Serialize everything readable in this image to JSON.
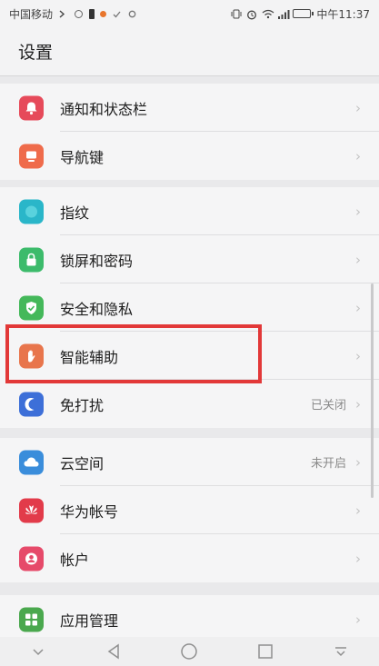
{
  "status_bar": {
    "carrier": "中国移动",
    "time": "中午11:37"
  },
  "header": {
    "title": "设置"
  },
  "groups": [
    {
      "items": [
        {
          "label": "通知和状态栏",
          "icon": "bell-icon",
          "color": "#e64a5a"
        },
        {
          "label": "导航键",
          "icon": "navigation-key-icon",
          "color": "#ef6b4b"
        }
      ]
    },
    {
      "items": [
        {
          "label": "指纹",
          "icon": "fingerprint-icon",
          "color": "#2ab6c9"
        },
        {
          "label": "锁屏和密码",
          "icon": "lock-icon",
          "color": "#3cbb6b"
        },
        {
          "label": "安全和隐私",
          "icon": "shield-icon",
          "color": "#44b85a"
        },
        {
          "label": "智能辅助",
          "icon": "hand-icon",
          "color": "#e8754c"
        },
        {
          "label": "免打扰",
          "icon": "moon-icon",
          "color": "#3d6fd8",
          "value": "已关闭"
        }
      ]
    },
    {
      "items": [
        {
          "label": "云空间",
          "icon": "cloud-icon",
          "color": "#3a8ddb",
          "value": "未开启"
        },
        {
          "label": "华为帐号",
          "icon": "huawei-icon",
          "color": "#e23b4a"
        },
        {
          "label": "帐户",
          "icon": "account-icon",
          "color": "#e64a6a"
        }
      ]
    },
    {
      "items": [
        {
          "label": "应用管理",
          "icon": "apps-icon",
          "color": "#4aa84e"
        }
      ]
    }
  ]
}
